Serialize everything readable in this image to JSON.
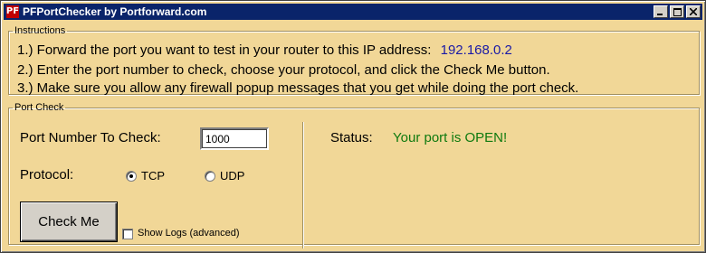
{
  "window": {
    "icon_text": "PF",
    "title": "PFPortChecker by Portforward.com"
  },
  "instructions": {
    "legend": "Instructions",
    "line1_text": "1.) Forward the port you want to test in your router to this IP address:",
    "ip_address": "192.168.0.2",
    "line2": "2.) Enter the port number to check, choose your protocol, and click the Check Me button.",
    "line3": "3.) Make sure you allow any firewall popup messages that you get while doing the port check."
  },
  "port_check": {
    "legend": "Port Check",
    "port_label": "Port Number  To Check:",
    "port_value": "1000",
    "protocol_label": "Protocol:",
    "tcp_label": "TCP",
    "udp_label": "UDP",
    "selected_protocol": "TCP",
    "check_button": "Check Me",
    "show_logs_label": "Show Logs (advanced)",
    "show_logs_checked": false,
    "status_label": "Status:",
    "status_value": "Your port is OPEN!",
    "status_color": "#0f7a0f"
  },
  "colors": {
    "window_bg": "#f1d797",
    "titlebar": "#0a246a",
    "ip_color": "#1a1aa6"
  }
}
